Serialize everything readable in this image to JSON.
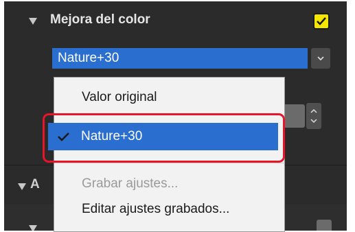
{
  "section": {
    "title": "Mejora del color",
    "expanded_icon": "triangle-down-icon",
    "enabled": true
  },
  "picture_control": {
    "selected_value": "Nature+30",
    "arrow_icon": "chevron-down-icon"
  },
  "menu": {
    "items": [
      {
        "label": "Valor original",
        "checked": false,
        "disabled": false
      },
      {
        "label": "Nature+30",
        "checked": true,
        "disabled": false
      },
      {
        "label": "Grabar ajustes...",
        "checked": false,
        "disabled": true
      },
      {
        "label": "Editar ajustes grabados...",
        "checked": false,
        "disabled": false
      }
    ]
  },
  "section2": {
    "title_fragment": "A"
  },
  "colors": {
    "panel_bg": "#2b2b2b",
    "accent_blue": "#2a6fd0",
    "highlight_red": "#e8142a",
    "checkbox_yellow": "#f5e600"
  }
}
